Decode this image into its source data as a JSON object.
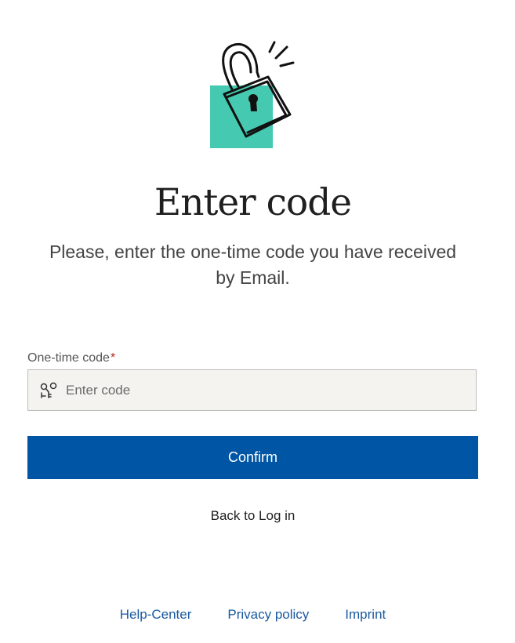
{
  "illustration": {
    "icon": "unlocked-padlock-icon",
    "accent_color": "#45c9b0"
  },
  "header": {
    "title": "Enter code",
    "subtitle": "Please, enter the one-time code you have received by Email."
  },
  "form": {
    "code_label": "One-time code",
    "required_marker": "*",
    "code_placeholder": "Enter code",
    "code_value": "",
    "code_icon": "key-icon",
    "confirm_label": "Confirm",
    "confirm_color": "#0055a4"
  },
  "links": {
    "back_label": "Back to Log in"
  },
  "footer": {
    "links": [
      {
        "label": "Help-Center"
      },
      {
        "label": "Privacy policy"
      },
      {
        "label": "Imprint"
      }
    ]
  }
}
